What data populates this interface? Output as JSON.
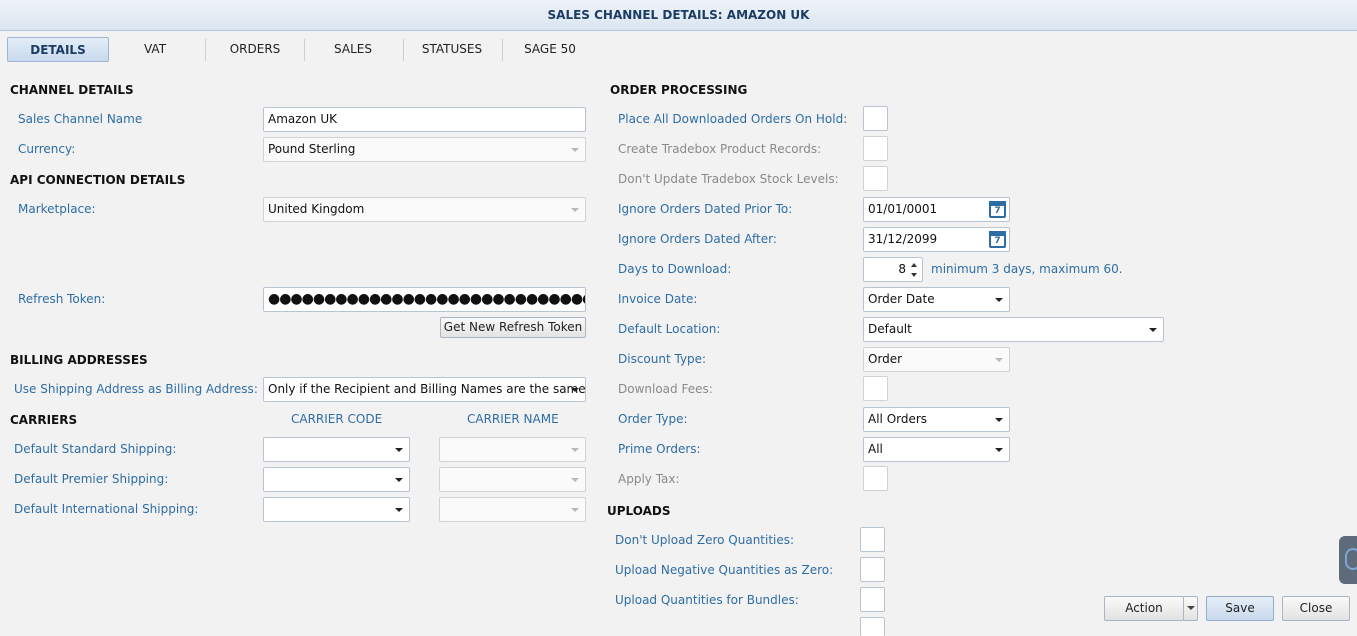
{
  "window": {
    "title": "SALES CHANNEL DETAILS: AMAZON UK"
  },
  "tabs": [
    "DETAILS",
    "VAT",
    "ORDERS",
    "SALES",
    "STATUSES",
    "SAGE 50"
  ],
  "left": {
    "channel_details": {
      "heading": "CHANNEL DETAILS",
      "name_label": "Sales Channel Name",
      "name_value": "Amazon UK",
      "currency_label": "Currency:",
      "currency_value": "Pound Sterling"
    },
    "api": {
      "heading": "API CONNECTION DETAILS",
      "marketplace_label": "Marketplace:",
      "marketplace_value": "United Kingdom",
      "token_label": "Refresh Token:",
      "token_value": "●●●●●●●●●●●●●●●●●●●●●●●●●●●●●●●●●●",
      "token_button": "Get New Refresh Token"
    },
    "billing": {
      "heading": "BILLING ADDRESSES",
      "label": "Use Shipping Address as Billing Address:",
      "value": "Only if the Recipient and Billing Names are the same"
    },
    "carriers": {
      "heading": "CARRIERS",
      "col_code": "CARRIER CODE",
      "col_name": "CARRIER NAME",
      "rows": [
        {
          "label": "Default Standard Shipping:",
          "code": "",
          "name": ""
        },
        {
          "label": "Default Premier Shipping:",
          "code": "",
          "name": ""
        },
        {
          "label": "Default International Shipping:",
          "code": "",
          "name": ""
        }
      ]
    }
  },
  "order_processing": {
    "heading": "ORDER PROCESSING",
    "place_on_hold_label": "Place All Downloaded Orders On Hold:",
    "create_records_label": "Create Tradebox Product Records:",
    "dont_update_stock_label": "Don't Update Tradebox Stock Levels:",
    "ignore_prior_label": "Ignore Orders Dated Prior To:",
    "ignore_prior_value": "01/01/0001",
    "ignore_after_label": "Ignore Orders Dated After:",
    "ignore_after_value": "31/12/2099",
    "days_label": "Days to Download:",
    "days_value": "8",
    "days_note": "minimum 3 days, maximum 60.",
    "invoice_date_label": "Invoice Date:",
    "invoice_date_value": "Order Date",
    "default_location_label": "Default Location:",
    "default_location_value": "Default",
    "discount_type_label": "Discount Type:",
    "discount_type_value": "Order",
    "download_fees_label": "Download Fees:",
    "order_type_label": "Order Type:",
    "order_type_value": "All Orders",
    "prime_orders_label": "Prime Orders:",
    "prime_orders_value": "All",
    "apply_tax_label": "Apply Tax:",
    "calendar_glyph": "7"
  },
  "uploads": {
    "heading": "UPLOADS",
    "zero_label": "Don't Upload Zero Quantities:",
    "negative_label": "Upload Negative Quantities as Zero:",
    "bundles_label": "Upload Quantities for Bundles:"
  },
  "footer": {
    "action": "Action",
    "save": "Save",
    "close": "Close"
  }
}
